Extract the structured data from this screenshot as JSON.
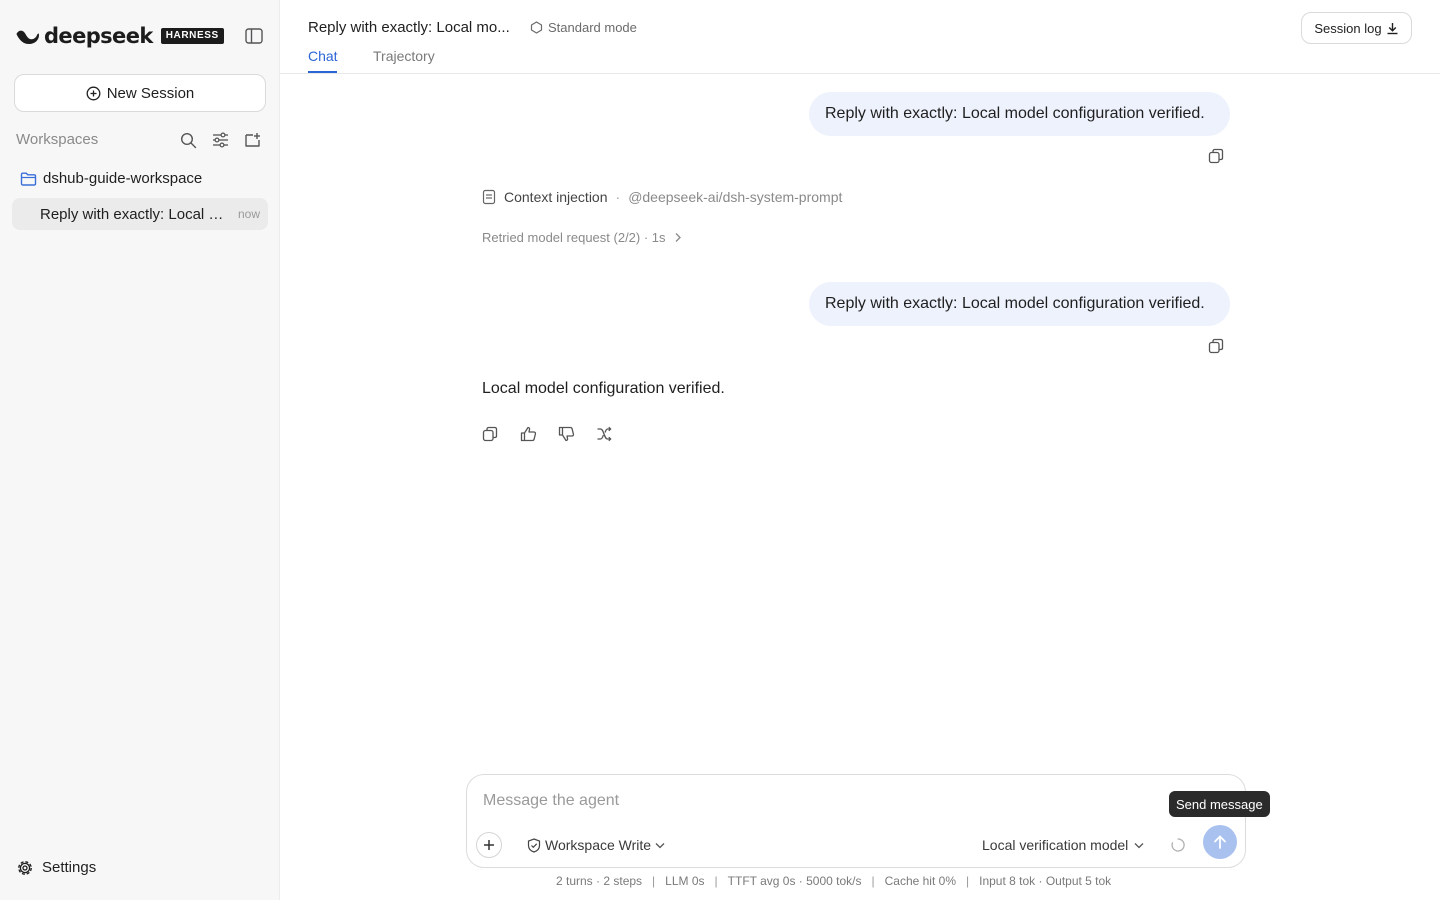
{
  "sidebar": {
    "logo_text": "deepseek",
    "logo_badge": "HARNESS",
    "new_session_label": "New Session",
    "workspaces_label": "Workspaces",
    "workspace_name": "dshub-guide-workspace",
    "session": {
      "title": "Reply with exactly: Local m...",
      "time": "now"
    },
    "settings_label": "Settings"
  },
  "header": {
    "title": "Reply with exactly: Local mo...",
    "mode": "Standard mode",
    "tabs": [
      {
        "label": "Chat",
        "active": true
      },
      {
        "label": "Trajectory",
        "active": false
      }
    ],
    "session_log_label": "Session log"
  },
  "chat": {
    "messages": [
      {
        "role": "user",
        "text": "Reply with exactly: Local model configuration verified."
      },
      {
        "role": "user",
        "text": "Reply with exactly: Local model configuration verified."
      },
      {
        "role": "assistant",
        "text": "Local model configuration verified."
      }
    ],
    "context": {
      "label": "Context injection",
      "separator": "·",
      "source": "@deepseek-ai/dsh-system-prompt"
    },
    "retry_text": "Retried model request (2/2) · 1s"
  },
  "composer": {
    "placeholder": "Message the agent",
    "value": "",
    "permission": "Workspace Write",
    "model": "Local verification model",
    "send_tooltip": "Send message"
  },
  "stats": {
    "separator": "|",
    "items": [
      "2 turns · 2 steps",
      "LLM 0s",
      "TTFT avg 0s · 5000 tok/s",
      "Cache hit 0%",
      "Input 8 tok · Output 5 tok"
    ]
  },
  "colors": {
    "accent": "#2b66d6",
    "user_bubble": "#eef2fd",
    "send_button": "#a9c1ef",
    "sidebar_bg": "#f7f7f8",
    "folder_icon": "#3b6fd8"
  }
}
